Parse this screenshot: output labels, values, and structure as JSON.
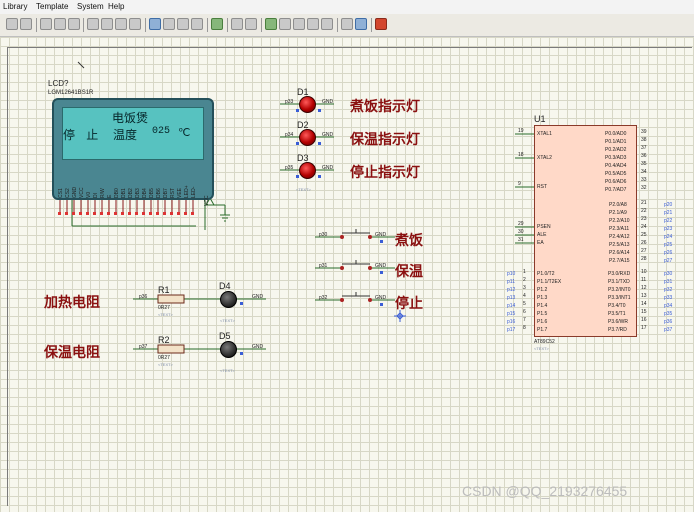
{
  "menu": {
    "items": [
      "Library",
      "Template",
      "System",
      "Help"
    ]
  },
  "toolbar": {
    "buttons": [
      "undo",
      "redo",
      "cut",
      "copy",
      "paste",
      "block-copy",
      "block-move",
      "block-rotate",
      "block-delete",
      "zoom",
      "wire-autoroute",
      "search",
      "property",
      "netlist",
      "tag",
      "bom",
      "erc",
      "electrical-rules",
      "design-explorer",
      "make-device",
      "package",
      "pdf",
      "export"
    ]
  },
  "lcd": {
    "ref": "LCD?",
    "part": "LGM12641BS1R",
    "line1": "电饭煲",
    "line2_status": "停 止",
    "line2_label": "温度",
    "line2_value": "025",
    "line2_unit": "℃",
    "pins": [
      "CS1",
      "CS2",
      "GND",
      "VCC",
      "V0",
      "DI",
      "R/W",
      "E",
      "DB0",
      "DB1",
      "DB2",
      "DB3",
      "DB4",
      "DB5",
      "DB6",
      "DB7",
      "RST",
      "VEE",
      "LED+",
      "LED-"
    ],
    "vcc_label": "VCC"
  },
  "leds": [
    {
      "ref": "D1",
      "net": "p33",
      "gnd": "GND",
      "label": "煮饭指示灯",
      "lit": true
    },
    {
      "ref": "D2",
      "net": "p34",
      "gnd": "GND",
      "label": "保温指示灯",
      "lit": true
    },
    {
      "ref": "D3",
      "net": "p35",
      "gnd": "GND",
      "label": "停止指示灯",
      "lit": true
    }
  ],
  "switches": [
    {
      "net": "p30",
      "gnd": "GND",
      "label": "煮饭"
    },
    {
      "net": "p31",
      "gnd": "GND",
      "label": "保温"
    },
    {
      "net": "p32",
      "gnd": "GND",
      "label": "停止"
    }
  ],
  "heaters": [
    {
      "label": "加热电阻",
      "net": "p36",
      "resistor": "R1",
      "value": "0R27",
      "led": "D4",
      "gnd": "GND",
      "lit": false
    },
    {
      "label": "保温电阻",
      "net": "p37",
      "resistor": "R2",
      "value": "0R27",
      "led": "D5",
      "gnd": "GND",
      "lit": false
    }
  ],
  "mcu": {
    "ref": "U1",
    "part": "AT89C52",
    "text": "<TEXT>",
    "left_pins": [
      {
        "num": "19",
        "name": "XTAL1"
      },
      {
        "num": "18",
        "name": "XTAL2"
      },
      {
        "num": "9",
        "name": "RST"
      },
      {
        "num": "29",
        "name": "PSEN"
      },
      {
        "num": "30",
        "name": "ALE"
      },
      {
        "num": "31",
        "name": "EA"
      }
    ],
    "p1_pins": [
      "P1.0/T2",
      "P1.1/T2EX",
      "P1.2",
      "P1.3",
      "P1.4",
      "P1.5",
      "P1.6",
      "P1.7"
    ],
    "p1_nets": [
      "p10",
      "p11",
      "p12",
      "p13",
      "p14",
      "p15",
      "p16",
      "p17"
    ],
    "p1_nums": [
      "1",
      "2",
      "3",
      "4",
      "5",
      "6",
      "7",
      "8"
    ],
    "p0_pins": [
      "P0.0/AD0",
      "P0.1/AD1",
      "P0.2/AD2",
      "P0.3/AD3",
      "P0.4/AD4",
      "P0.5/AD5",
      "P0.6/AD6",
      "P0.7/AD7"
    ],
    "p0_nums": [
      "39",
      "38",
      "37",
      "36",
      "35",
      "34",
      "33",
      "32"
    ],
    "p2_pins": [
      "P2.0/A8",
      "P2.1/A9",
      "P2.2/A10",
      "P2.3/A11",
      "P2.4/A12",
      "P2.5/A13",
      "P2.6/A14",
      "P2.7/A15"
    ],
    "p2_nums": [
      "21",
      "22",
      "23",
      "24",
      "25",
      "26",
      "27",
      "28"
    ],
    "p2_nets": [
      "p20",
      "p21",
      "p22",
      "p23",
      "p24",
      "p25",
      "p26",
      "p27"
    ],
    "p3_pins": [
      "P3.0/RXD",
      "P3.1/TXD",
      "P3.2/INT0",
      "P3.3/INT1",
      "P3.4/T0",
      "P3.5/T1",
      "P3.6/WR",
      "P3.7/RD"
    ],
    "p3_nums": [
      "10",
      "11",
      "12",
      "13",
      "14",
      "15",
      "16",
      "17"
    ],
    "p3_nets": [
      "p30",
      "p31",
      "p32",
      "p33",
      "p34",
      "p35",
      "p36",
      "p37"
    ]
  },
  "text_placeholder": "<TEXT>",
  "watermark": "CSDN @QQ_2193276455"
}
